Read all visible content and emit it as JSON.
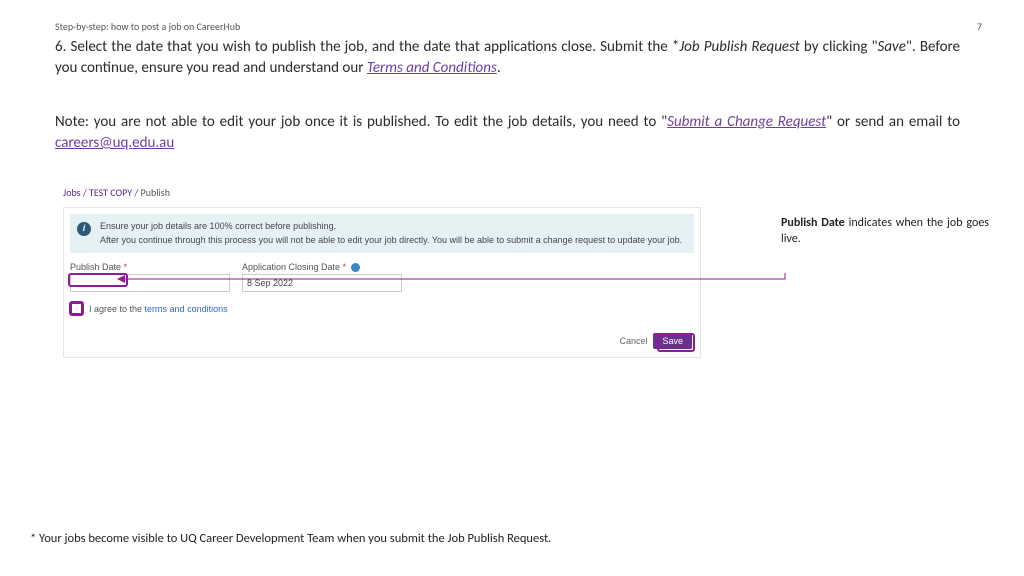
{
  "header": {
    "title": "Step-by-step: how to post a job on CareerHub",
    "page": "7"
  },
  "para1": {
    "lead": "6. Select the date that you wish to publish the job, and the date that applications close. Submit the *",
    "jpr": "Job Publish Request",
    "mid1": " by clicking \"",
    "save": "Save",
    "mid2": "\". Before you continue, ensure you read and understand our ",
    "tnc": "Terms and Conditions",
    "end": "."
  },
  "para2": {
    "lead": "Note: you are not able to edit your job once it is published. To edit the job details, you need to \"",
    "scr": "Submit a Change Request",
    "mid": "\" or send an email to ",
    "email": "careers@uq.edu.au"
  },
  "crumbs": {
    "a": "Jobs",
    "b": "TEST COPY",
    "c": "Publish",
    "sep": "  /  "
  },
  "alert": {
    "line1": "Ensure your job details are 100% correct before publishing.",
    "line2": "After you continue through this process you will not be able to edit your job directly. You will be able to submit a change request to update your job."
  },
  "form": {
    "publish_label": "Publish Date ",
    "closing_label": "Application Closing Date ",
    "req": "*",
    "closing_value": "8 Sep 2022",
    "agree_pre": "I agree to the ",
    "agree_link": "terms and conditions",
    "cancel": "Cancel",
    "save": "Save"
  },
  "callout": {
    "bold": "Publish Date",
    "rest": " indicates when the job goes live."
  },
  "footnote": "* Your jobs become visible to UQ Career Development Team when you submit the Job Publish Request."
}
